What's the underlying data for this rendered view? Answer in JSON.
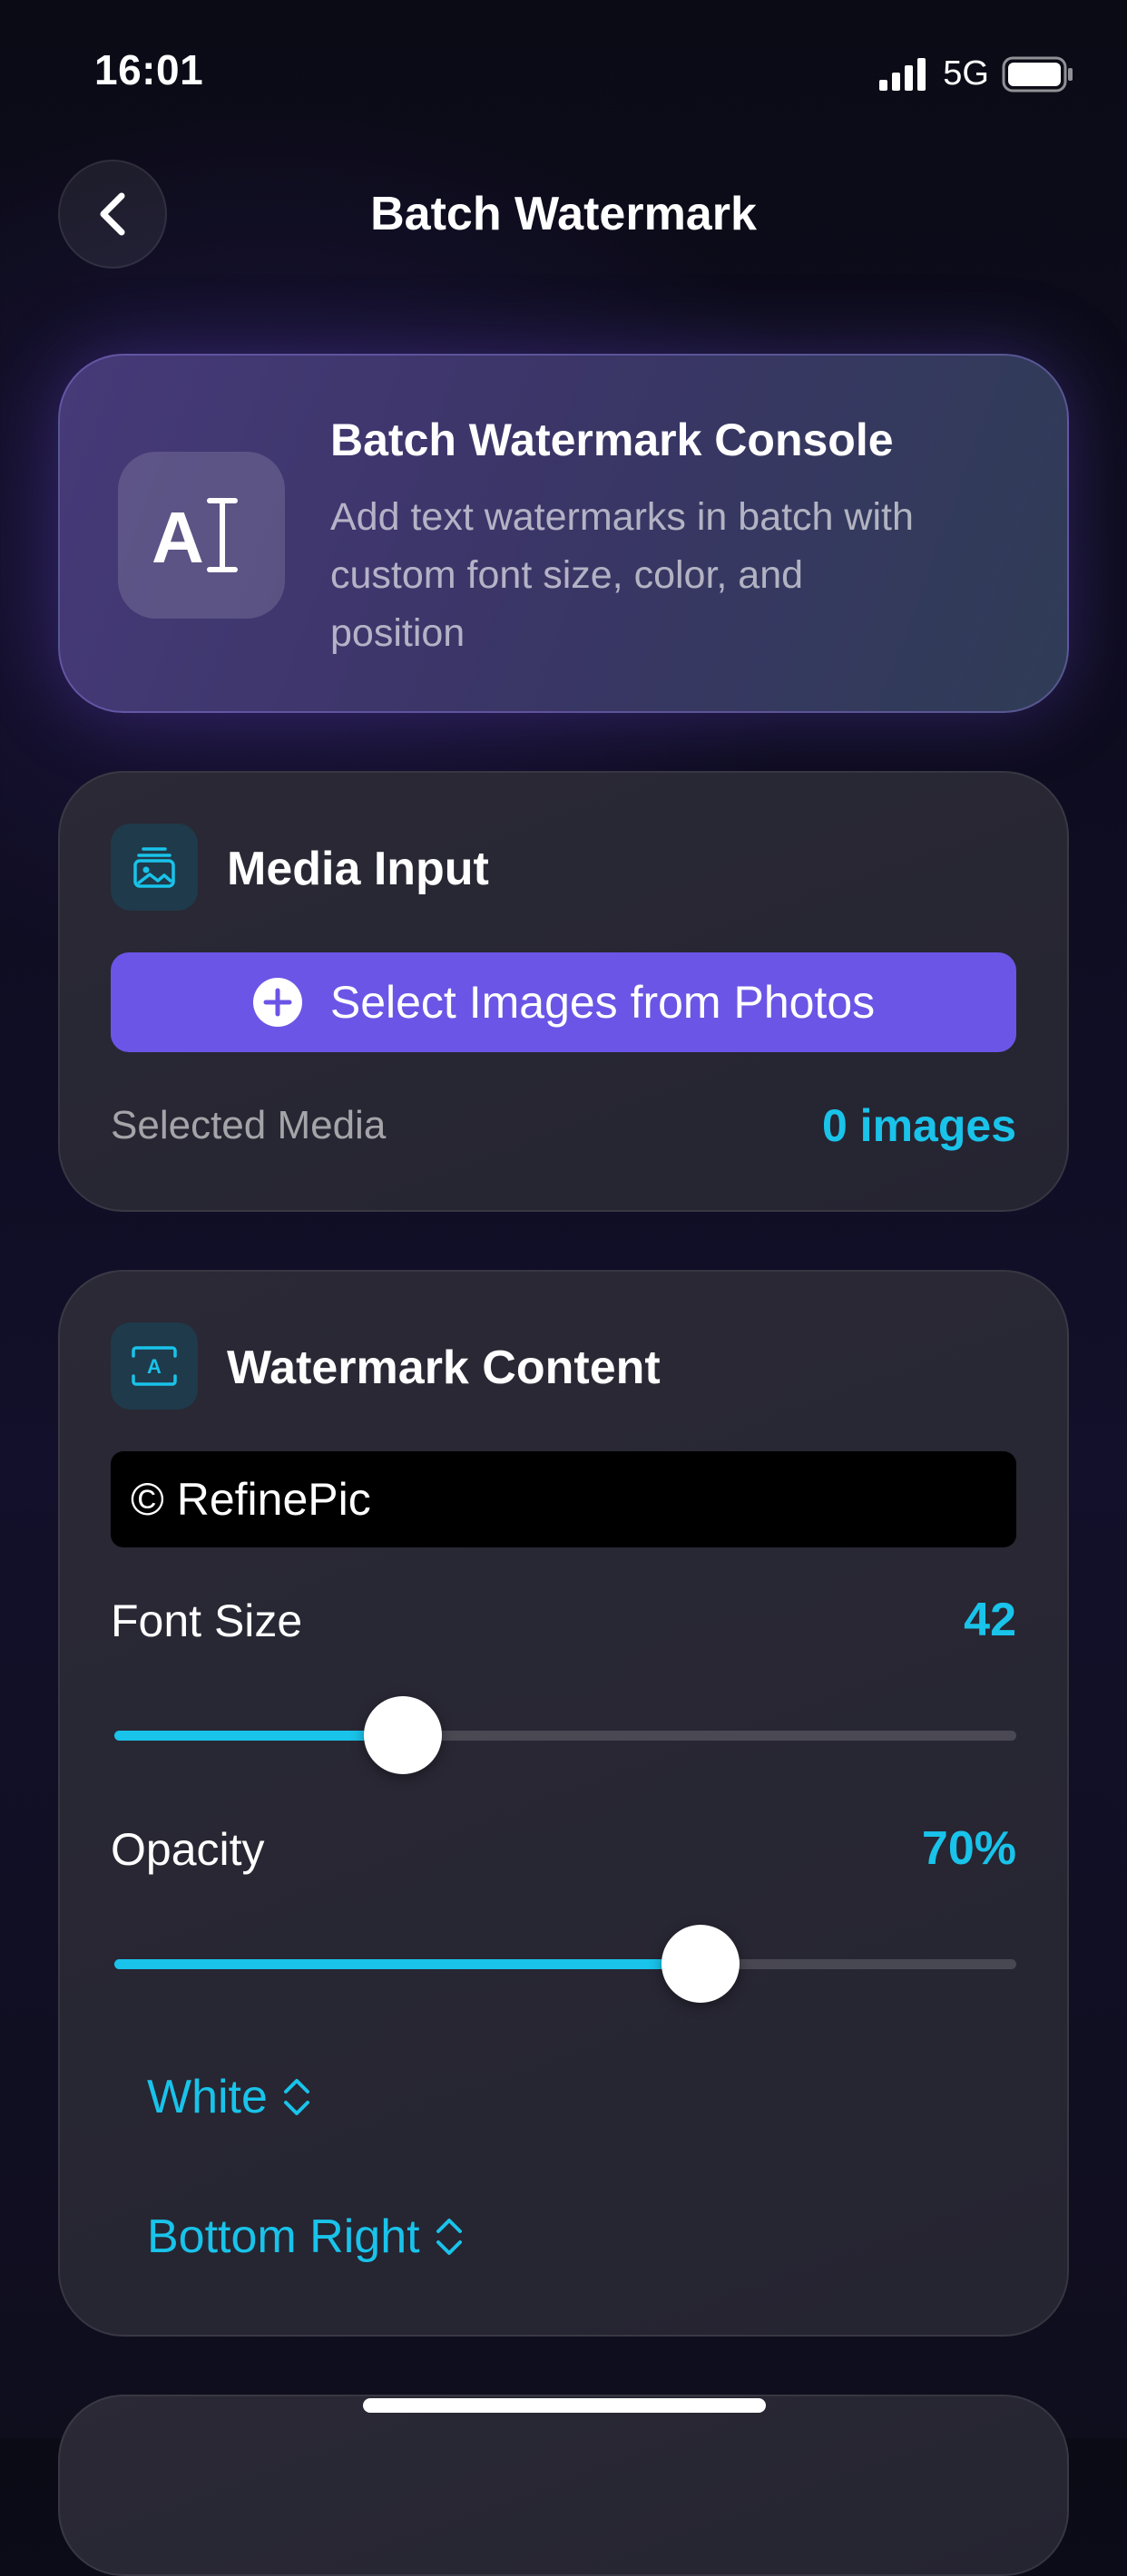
{
  "status_bar": {
    "time": "16:01",
    "network": "5G",
    "icons": [
      "signal-icon",
      "battery-icon"
    ]
  },
  "nav": {
    "title": "Batch Watermark",
    "back_icon": "chevron-left-icon"
  },
  "hero": {
    "icon": "text-cursor-icon",
    "icon_glyph": "AI",
    "title": "Batch Watermark Console",
    "description": "Add text watermarks in batch with custom font size, color, and position"
  },
  "media_input": {
    "icon": "photo-stack-icon",
    "title": "Media Input",
    "select_button_label": "Select Images from Photos",
    "select_button_icon": "plus-circle-icon",
    "selected_label": "Selected Media",
    "selected_count": "0 images"
  },
  "watermark_content": {
    "icon": "text-box-icon",
    "title": "Watermark Content",
    "text_value": "© RefinePic",
    "font_size": {
      "label": "Font Size",
      "value": "42",
      "fraction": 0.32
    },
    "opacity": {
      "label": "Opacity",
      "value": "70%",
      "fraction": 0.65
    },
    "color_picker": "White",
    "position_picker": "Bottom Right"
  },
  "colors": {
    "accent": "#19c3ea",
    "button": "#6b55e6",
    "card": "#2a2935",
    "background": "#0e0c1f"
  }
}
